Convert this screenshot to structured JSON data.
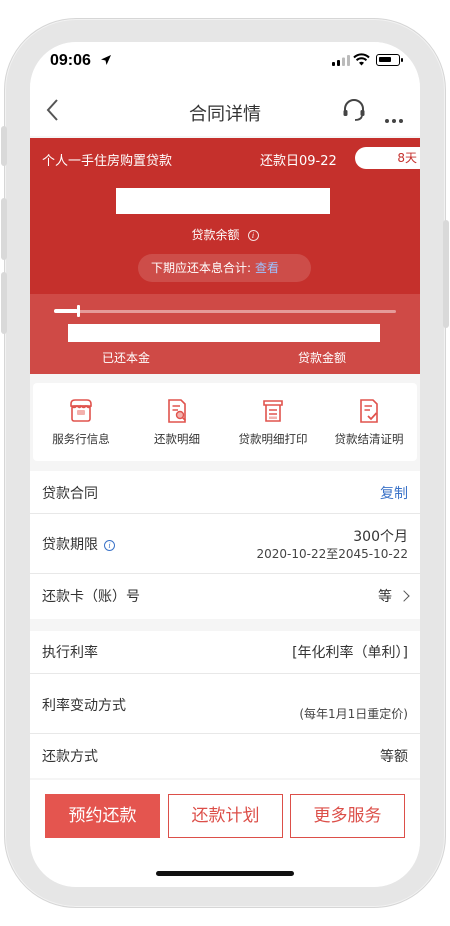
{
  "status_bar": {
    "time": "09:06"
  },
  "nav": {
    "title": "合同详情"
  },
  "loan_card": {
    "loan_name": "个人一手住房购置贷款",
    "repayment_day": "还款日09-22",
    "days_left": "8天",
    "balance_label": "贷款余额",
    "next_period_label": "下期应还本息合计:",
    "next_period_link": "查看",
    "repaid_progress": 0.07,
    "repaid_principal_label": "已还本金",
    "loan_amount_label": "贷款金额"
  },
  "actions": [
    {
      "label": "服务行信息",
      "icon": "bank-icon"
    },
    {
      "label": "还款明细",
      "icon": "document-search-icon"
    },
    {
      "label": "贷款明细打印",
      "icon": "print-scroll-icon"
    },
    {
      "label": "贷款结清证明",
      "icon": "document-check-icon"
    }
  ],
  "contract": {
    "label": "贷款合同",
    "action": "复制"
  },
  "term": {
    "label": "贷款期限",
    "value": "300个月",
    "range": "2020-10-22至2045-10-22"
  },
  "card": {
    "label": "还款卡（账）号",
    "value": "等"
  },
  "rate": {
    "label": "执行利率",
    "value": "[年化利率（单利）]"
  },
  "rate_change": {
    "label": "利率变动方式",
    "value": "(每年1月1日重定价)"
  },
  "repay_method": {
    "label": "还款方式",
    "value": "等额"
  },
  "buttons": {
    "book": "预约还款",
    "plan": "还款计划",
    "more": "更多服务"
  },
  "colors": {
    "brand_red": "#c5302c",
    "link_blue": "#3b73c8"
  }
}
